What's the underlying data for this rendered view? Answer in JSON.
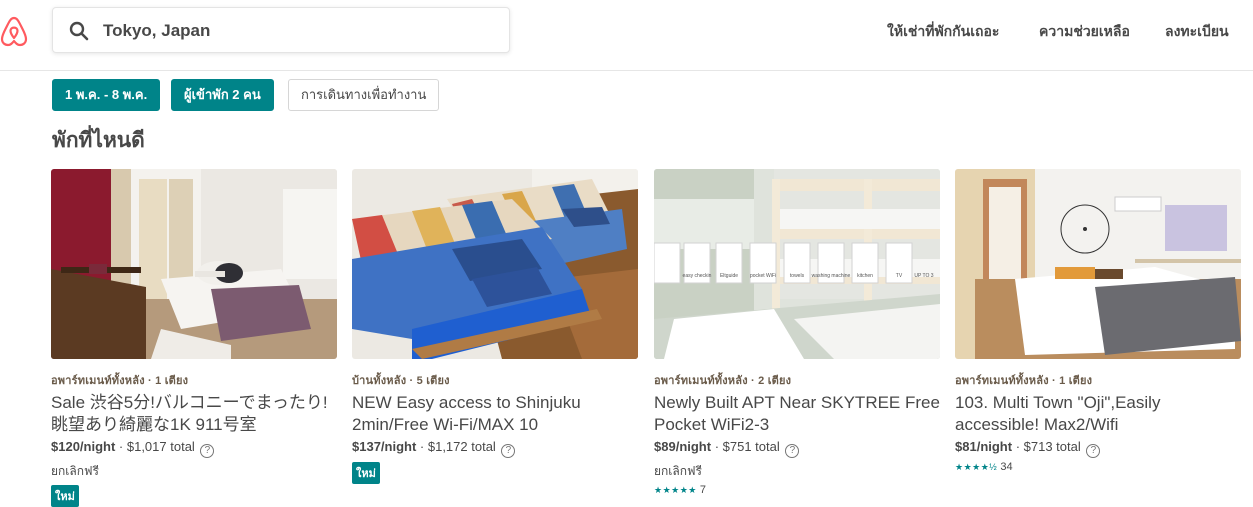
{
  "header": {
    "search_value": "Tokyo, Japan",
    "nav": [
      "ให้เช่าที่พักกันเถอะ",
      "ความช่วยเหลือ",
      "ลงทะเบียน"
    ]
  },
  "filters": [
    {
      "label": "1 พ.ค. - 8 พ.ค.",
      "active": true
    },
    {
      "label": "ผู้เข้าพัก 2 คน",
      "active": true
    },
    {
      "label": "การเดินทางเพื่อทำงาน",
      "active": false
    }
  ],
  "section_title": "พักที่ไหนดี",
  "listings": [
    {
      "kind": "อพาร์ทเมนท์ทั้งหลัง · 1 เตียง",
      "title": "Sale 渋谷5分!バルコニーでまったり!眺望あり綺麗な1K 911号室",
      "price": "$120",
      "per_night": "/night",
      "total": " · $1,017 total",
      "cancel": "ยกเลิกฟรี",
      "badge": "ใหม่"
    },
    {
      "kind": "บ้านทั้งหลัง · 5 เตียง",
      "title": "NEW Easy access to Shinjuku 2min/Free Wi-Fi/MAX 10",
      "price": "$137",
      "per_night": "/night",
      "total": " · $1,172 total",
      "badge": "ใหม่"
    },
    {
      "kind": "อพาร์ทเมนท์ทั้งหลัง · 2 เตียง",
      "title": "Newly Built APT Near SKYTREE Free Pocket WiFi2-3",
      "price": "$89",
      "per_night": "/night",
      "total": " · $751 total",
      "cancel": "ยกเลิกฟรี",
      "stars": "★★★★★",
      "reviews": "7"
    },
    {
      "kind": "อพาร์ทเมนท์ทั้งหลัง · 1 เตียง",
      "title": "103. Multi Town \"Oji\",Easily accessible! Max2/Wifi",
      "price": "$81",
      "per_night": "/night",
      "total": " · $713 total",
      "stars": "★★★★½",
      "reviews": "34"
    }
  ],
  "photo_amenity_labels": [
    "easy checkin",
    "Eltguide",
    "pocket WiFi",
    "towels",
    "washing machine",
    "kitchen",
    "TV",
    "UP TO 3"
  ],
  "icons": {
    "logo": "airbnb-logo-icon",
    "search": "search-icon",
    "help": "question-circle-icon"
  },
  "colors": {
    "brand": "#FF5A5F",
    "accent_teal": "#008489",
    "text": "#484848"
  }
}
